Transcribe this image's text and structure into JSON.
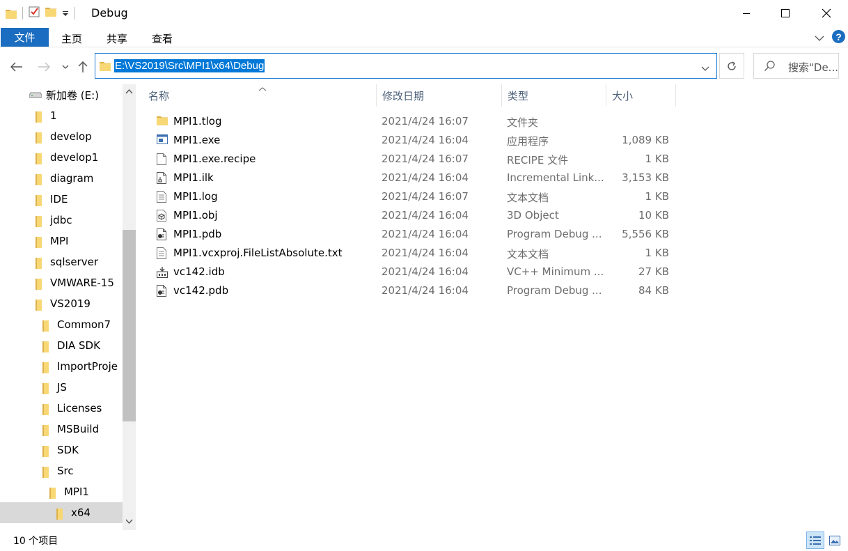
{
  "window": {
    "title": "Debug"
  },
  "ribbon": {
    "tabs": [
      "文件",
      "主页",
      "共享",
      "查看"
    ],
    "help": "?"
  },
  "address": {
    "path": "E:\\VS2019\\Src\\MPI1\\x64\\Debug",
    "search_placeholder": "搜索\"De..."
  },
  "nav_pane": {
    "drive": "新加卷 (E:)",
    "items": [
      {
        "label": "1",
        "level": 1
      },
      {
        "label": "develop",
        "level": 1
      },
      {
        "label": "develop1",
        "level": 1
      },
      {
        "label": "diagram",
        "level": 1
      },
      {
        "label": "IDE",
        "level": 1
      },
      {
        "label": "jdbc",
        "level": 1
      },
      {
        "label": "MPI",
        "level": 1
      },
      {
        "label": "sqlserver",
        "level": 1
      },
      {
        "label": "VMWARE-15",
        "level": 1
      },
      {
        "label": "VS2019",
        "level": 1
      },
      {
        "label": "Common7",
        "level": 2
      },
      {
        "label": "DIA SDK",
        "level": 2
      },
      {
        "label": "ImportProje",
        "level": 2
      },
      {
        "label": "JS",
        "level": 2
      },
      {
        "label": "Licenses",
        "level": 2
      },
      {
        "label": "MSBuild",
        "level": 2
      },
      {
        "label": "SDK",
        "level": 2
      },
      {
        "label": "Src",
        "level": 2
      },
      {
        "label": "MPI1",
        "level": 3
      },
      {
        "label": "x64",
        "level": 4,
        "selected": true
      }
    ]
  },
  "columns": {
    "name": "名称",
    "date": "修改日期",
    "type": "类型",
    "size": "大小"
  },
  "files": [
    {
      "name": "MPI1.tlog",
      "date": "2021/4/24 16:07",
      "type": "文件夹",
      "size": "",
      "icon": "folder-icon"
    },
    {
      "name": "MPI1.exe",
      "date": "2021/4/24 16:04",
      "type": "应用程序",
      "size": "1,089 KB",
      "icon": "exe-icon"
    },
    {
      "name": "MPI1.exe.recipe",
      "date": "2021/4/24 16:07",
      "type": "RECIPE 文件",
      "size": "1 KB",
      "icon": "blank-file-icon"
    },
    {
      "name": "MPI1.ilk",
      "date": "2021/4/24 16:04",
      "type": "Incremental Link...",
      "size": "3,153 KB",
      "icon": "ilk-file-icon"
    },
    {
      "name": "MPI1.log",
      "date": "2021/4/24 16:07",
      "type": "文本文档",
      "size": "1 KB",
      "icon": "text-file-icon"
    },
    {
      "name": "MPI1.obj",
      "date": "2021/4/24 16:04",
      "type": "3D Object",
      "size": "10 KB",
      "icon": "3d-object-icon"
    },
    {
      "name": "MPI1.pdb",
      "date": "2021/4/24 16:04",
      "type": "Program Debug ...",
      "size": "5,556 KB",
      "icon": "pdb-file-icon"
    },
    {
      "name": "MPI1.vcxproj.FileListAbsolute.txt",
      "date": "2021/4/24 16:04",
      "type": "文本文档",
      "size": "1 KB",
      "icon": "text-file-icon"
    },
    {
      "name": "vc142.idb",
      "date": "2021/4/24 16:04",
      "type": "VC++ Minimum ...",
      "size": "27 KB",
      "icon": "idb-file-icon"
    },
    {
      "name": "vc142.pdb",
      "date": "2021/4/24 16:04",
      "type": "Program Debug ...",
      "size": "84 KB",
      "icon": "pdb-file-icon"
    }
  ],
  "status": {
    "item_count": "10 个项目"
  },
  "colors": {
    "accent": "#0078d7",
    "file_tab": "#1a6dc0",
    "folder": "#f8d775",
    "secondary_text": "#6d6d6d"
  }
}
